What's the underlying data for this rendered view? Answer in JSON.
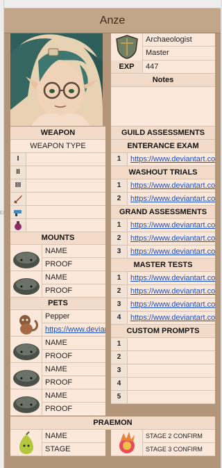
{
  "character": {
    "name": "Anze",
    "class": "Archaeologist",
    "rank": "Master",
    "exp_label": "EXP",
    "exp_value": "447",
    "notes_label": "Notes"
  },
  "weapon": {
    "header": "WEAPON",
    "type_label": "WEAPON TYPE",
    "rows": [
      "I",
      "II",
      "III",
      "",
      "",
      ""
    ],
    "icons": [
      "sword-icon",
      "blaster-icon",
      "potion-icon"
    ]
  },
  "mounts": {
    "header": "MOUNTS",
    "rows": [
      {
        "name_label": "NAME",
        "proof_label": "PROOF",
        "icon": "rock-creature-icon"
      },
      {
        "name_label": "NAME",
        "proof_label": "PROOF",
        "icon": "rock-creature-icon"
      }
    ]
  },
  "pets": {
    "header": "PETS",
    "rows": [
      {
        "name": "Pepper",
        "proof": "https://www.deviantart.com/",
        "icon": "monkey-pet-icon"
      },
      {
        "name": "NAME",
        "proof": "PROOF",
        "icon": "rock-creature-icon"
      },
      {
        "name": "NAME",
        "proof": "PROOF",
        "icon": "rock-creature-icon"
      },
      {
        "name": "NAME",
        "proof": "PROOF",
        "icon": "rock-creature-icon"
      },
      {
        "name": "NAME",
        "proof": "PROOF",
        "icon": "rock-creature-icon"
      }
    ]
  },
  "guild": {
    "header": "GUILD ASSESSMENTS",
    "entrance": {
      "header": "ENTERANCE EXAM",
      "rows": [
        {
          "num": "1",
          "link": "https://www.deviantart.com/"
        }
      ]
    },
    "washout": {
      "header": "WASHOUT TRIALS",
      "rows": [
        {
          "num": "1",
          "link": "https://www.deviantart.com/"
        },
        {
          "num": "2",
          "link": "https://www.deviantart.com/"
        }
      ]
    },
    "grand": {
      "header": "GRAND ASSESSMENTS",
      "rows": [
        {
          "num": "1",
          "link": "https://www.deviantart.com/"
        },
        {
          "num": "2",
          "link": "https://www.deviantart.com/"
        },
        {
          "num": "3",
          "link": "https://www.deviantart.com/"
        }
      ]
    },
    "master": {
      "header": "MASTER TESTS",
      "rows": [
        {
          "num": "1",
          "link": "https://www.deviantart.com/"
        },
        {
          "num": "2",
          "link": "https://www.deviantart.com/"
        },
        {
          "num": "3",
          "link": "https://www.deviantart.com/"
        },
        {
          "num": "4",
          "link": "https://www.deviantart.com/"
        }
      ]
    },
    "prompts": {
      "header": "CUSTOM PROMPTS",
      "rows": [
        "1",
        "2",
        "3",
        "4",
        "5"
      ]
    }
  },
  "praemon": {
    "header": "PRAEMON",
    "name_label": "NAME",
    "stage_label": "STAGE",
    "stage2_label": "STAGE 2 CONFIRM",
    "stage3_label": "STAGE 3 CONFIRM",
    "icons": [
      "pear-creature-icon",
      "flame-orb-icon"
    ]
  },
  "sheet": {
    "side_label": "EXP"
  },
  "colors": {
    "frame": "#b3967a",
    "cell": "#fbe8da",
    "header": "#f2dcc9",
    "link": "#1a4fc4",
    "title_bar": "#c2a68a"
  }
}
